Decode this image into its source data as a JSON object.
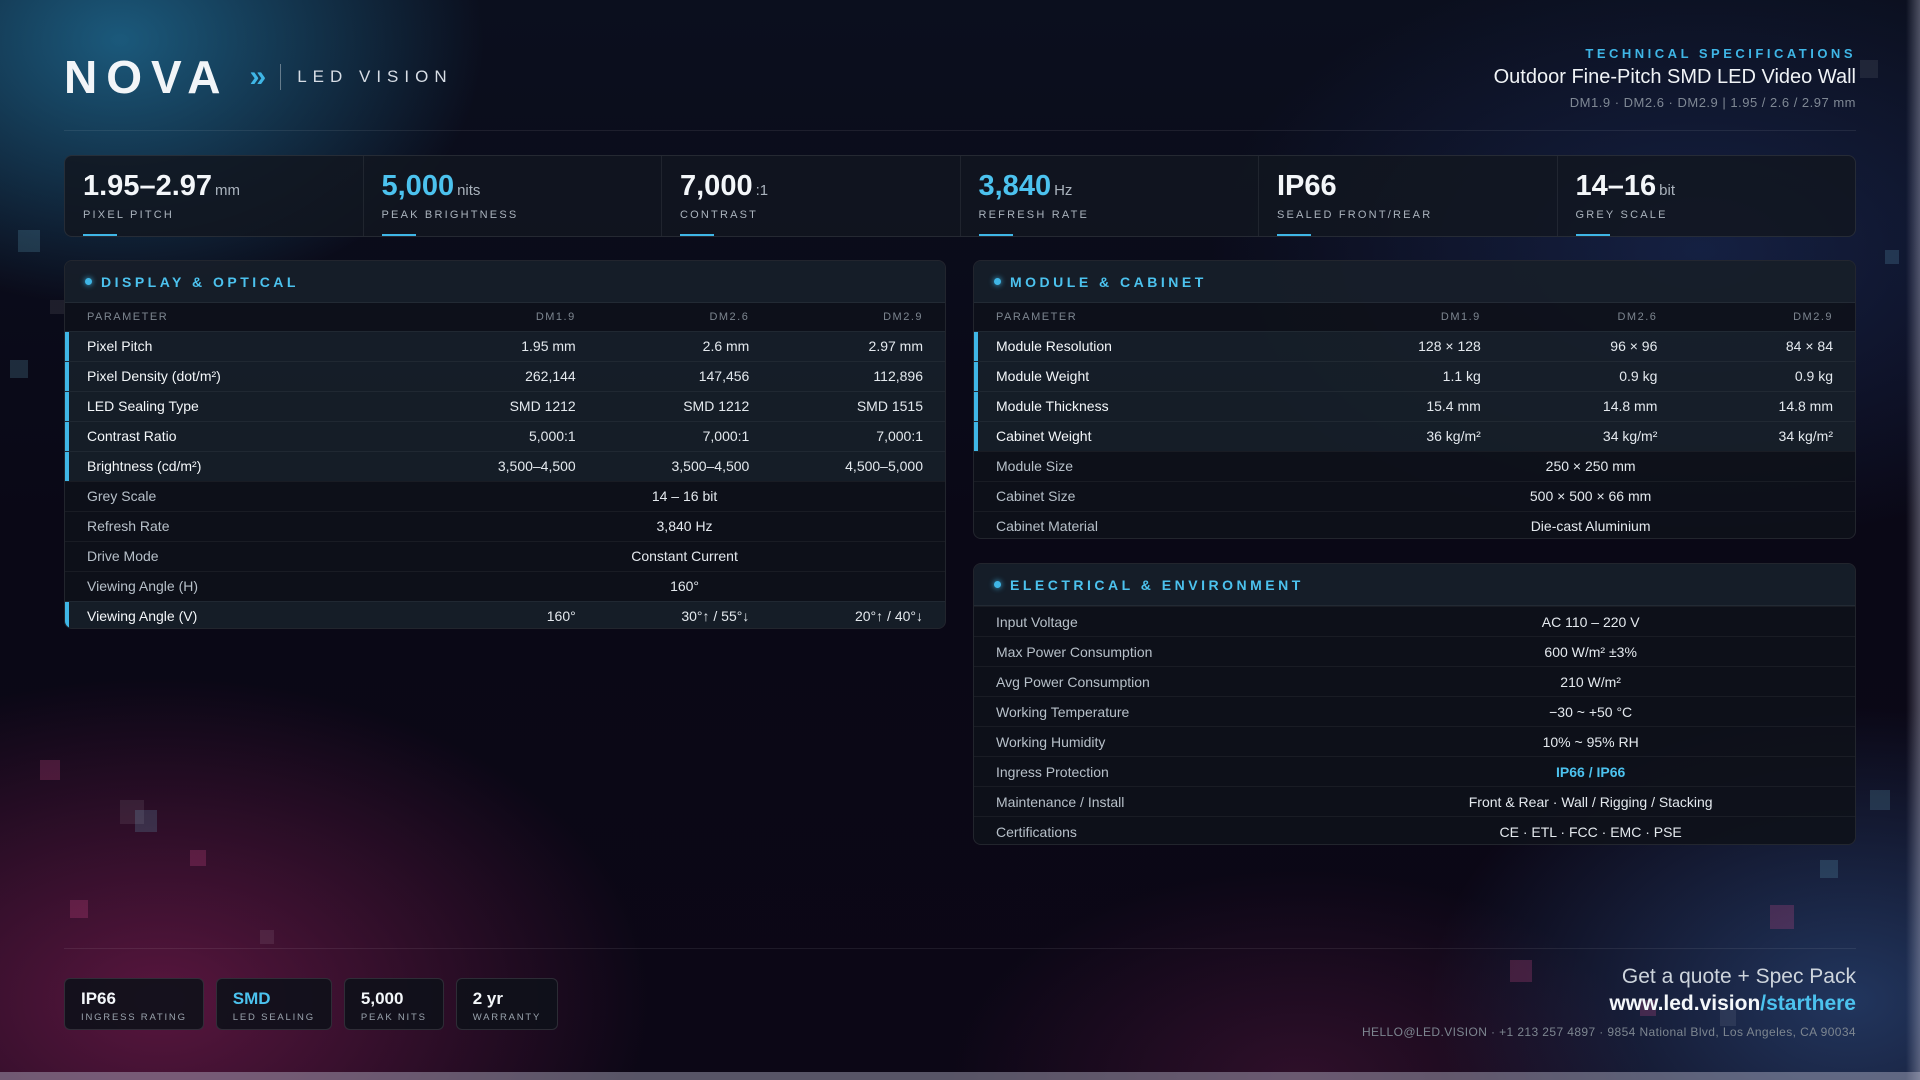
{
  "brand": {
    "name": "NOVA",
    "chevron": "»",
    "subtitle": "LED VISION"
  },
  "header": {
    "kicker": "TECHNICAL SPECIFICATIONS",
    "title": "Outdoor Fine-Pitch SMD LED Video Wall",
    "models": "DM1.9 · DM2.6 · DM2.9 | 1.95 / 2.6 / 2.97 mm"
  },
  "stats": [
    {
      "value": "1.95–2.97",
      "unit": "mm",
      "label": "PIXEL PITCH",
      "accent": false
    },
    {
      "value": "5,000",
      "unit": "nits",
      "label": "PEAK BRIGHTNESS",
      "accent": true
    },
    {
      "value": "7,000",
      "unit": ":1",
      "label": "CONTRAST",
      "accent": false
    },
    {
      "value": "3,840",
      "unit": "Hz",
      "label": "REFRESH RATE",
      "accent": true
    },
    {
      "value": "IP66",
      "unit": "",
      "label": "SEALED FRONT/REAR",
      "accent": false
    },
    {
      "value": "14–16",
      "unit": "bit",
      "label": "GREY SCALE",
      "accent": false
    }
  ],
  "display": {
    "title": "DISPLAY & OPTICAL",
    "columns": [
      "PARAMETER",
      "DM1.9",
      "DM2.6",
      "DM2.9"
    ],
    "rows": [
      {
        "label": "Pixel Pitch",
        "values": [
          "1.95 mm",
          "2.6 mm",
          "2.97 mm"
        ]
      },
      {
        "label": "Pixel Density (dot/m²)",
        "values": [
          "262,144",
          "147,456",
          "112,896"
        ]
      },
      {
        "label": "LED Sealing Type",
        "values": [
          "SMD 1212",
          "SMD 1212",
          "SMD 1515"
        ]
      },
      {
        "label": "Contrast Ratio",
        "values": [
          "5,000:1",
          "7,000:1",
          "7,000:1"
        ]
      },
      {
        "label": "Brightness (cd/m²)",
        "values": [
          "3,500–4,500",
          "3,500–4,500",
          "4,500–5,000"
        ]
      },
      {
        "label": "Grey Scale",
        "span": "14 – 16 bit"
      },
      {
        "label": "Refresh Rate",
        "span": "3,840 Hz"
      },
      {
        "label": "Drive Mode",
        "span": "Constant Current"
      },
      {
        "label": "Viewing Angle (H)",
        "span": "160°"
      },
      {
        "label": "Viewing Angle (V)",
        "values": [
          "160°",
          "30°↑ / 55°↓",
          "20°↑ / 40°↓"
        ]
      }
    ]
  },
  "module": {
    "title": "MODULE & CABINET",
    "columns": [
      "PARAMETER",
      "DM1.9",
      "DM2.6",
      "DM2.9"
    ],
    "rows": [
      {
        "label": "Module Resolution",
        "values": [
          "128 × 128",
          "96 × 96",
          "84 × 84"
        ]
      },
      {
        "label": "Module Weight",
        "values": [
          "1.1 kg",
          "0.9 kg",
          "0.9 kg"
        ]
      },
      {
        "label": "Module Thickness",
        "values": [
          "15.4 mm",
          "14.8 mm",
          "14.8 mm"
        ]
      },
      {
        "label": "Cabinet Weight",
        "values": [
          "36 kg/m²",
          "34 kg/m²",
          "34 kg/m²"
        ]
      },
      {
        "label": "Module Size",
        "span": "250 × 250 mm"
      },
      {
        "label": "Cabinet Size",
        "span": "500 × 500 × 66 mm"
      },
      {
        "label": "Cabinet Material",
        "span": "Die-cast Aluminium"
      }
    ]
  },
  "electrical": {
    "title": "ELECTRICAL & ENVIRONMENT",
    "rows": [
      {
        "label": "Input Voltage",
        "span": "AC 110 – 220 V"
      },
      {
        "label": "Max Power Consumption",
        "span": "600 W/m² ±3%"
      },
      {
        "label": "Avg Power Consumption",
        "span": "210 W/m²"
      },
      {
        "label": "Working Temperature",
        "span": "−30 ~ +50 °C"
      },
      {
        "label": "Working Humidity",
        "span": "10% ~ 95% RH"
      },
      {
        "label": "Ingress Protection",
        "span": "IP66 / IP66",
        "accent": true
      },
      {
        "label": "Maintenance / Install",
        "span": "Front & Rear · Wall / Rigging / Stacking"
      },
      {
        "label": "Certifications",
        "span": "CE · ETL · FCC · EMC · PSE"
      }
    ]
  },
  "chips": [
    {
      "value": "IP66",
      "label": "INGRESS RATING",
      "accent": false
    },
    {
      "value": "SMD",
      "label": "LED SEALING",
      "accent": true
    },
    {
      "value": "5,000",
      "label": "PEAK NITS",
      "accent": false
    },
    {
      "value": "2 yr",
      "label": "WARRANTY",
      "accent": false
    }
  ],
  "cta": {
    "line": "Get a quote + Spec Pack",
    "url_main": "www.led.vision",
    "url_path": "/starthere",
    "contact": "HELLO@LED.VISION · +1 213 257 4897 · 9854 National Blvd, Los Angeles, CA 90034"
  },
  "colors": {
    "accent": "#3fb6e6",
    "background": "#08080f",
    "panel": "#0e111a"
  }
}
